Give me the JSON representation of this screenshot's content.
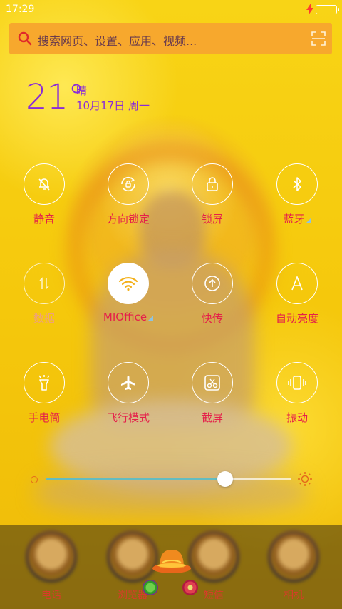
{
  "status_bar": {
    "time": "17:29",
    "charging": true
  },
  "search": {
    "placeholder": "搜索网页、设置、应用、视频..."
  },
  "weather": {
    "temperature": "21°",
    "condition": "晴",
    "date": "10月17日 周一"
  },
  "toggles": [
    {
      "label": "静音",
      "icon": "bell-off-icon",
      "active": false
    },
    {
      "label": "方向锁定",
      "icon": "rotation-lock-icon",
      "active": false
    },
    {
      "label": "锁屏",
      "icon": "lock-icon",
      "active": false
    },
    {
      "label": "蓝牙",
      "icon": "bluetooth-icon",
      "active": false,
      "has_menu": true
    },
    {
      "label": "数据",
      "icon": "mobile-data-icon",
      "active": false,
      "disabled": true
    },
    {
      "label": "MIOffice",
      "icon": "wifi-icon",
      "active": true,
      "has_menu": true
    },
    {
      "label": "快传",
      "icon": "quick-transfer-icon",
      "active": false
    },
    {
      "label": "自动亮度",
      "icon": "auto-brightness-icon",
      "active": false
    },
    {
      "label": "手电筒",
      "icon": "flashlight-icon",
      "active": false
    },
    {
      "label": "飞行模式",
      "icon": "airplane-icon",
      "active": false
    },
    {
      "label": "截屏",
      "icon": "screenshot-icon",
      "active": false
    },
    {
      "label": "振动",
      "icon": "vibrate-icon",
      "active": false
    }
  ],
  "brightness": {
    "level": 0.73
  },
  "dock": [
    {
      "label": "电话"
    },
    {
      "label": "浏览器"
    },
    {
      "label": "短信"
    },
    {
      "label": "相机"
    }
  ],
  "colors": {
    "accent_label": "#e5204a",
    "weather_text": "#8a2bd8",
    "search_bg": "#f7a82d",
    "slider_fill": "#64bcc0"
  }
}
